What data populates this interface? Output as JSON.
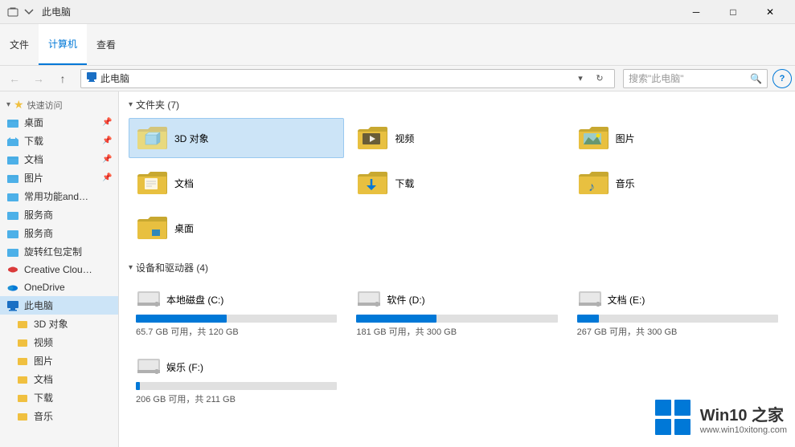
{
  "titleBar": {
    "title": "此电脑",
    "minLabel": "─",
    "maxLabel": "□",
    "closeLabel": "✕"
  },
  "ribbon": {
    "tabs": [
      {
        "id": "file",
        "label": "文件"
      },
      {
        "id": "computer",
        "label": "计算机"
      },
      {
        "id": "view",
        "label": "查看"
      }
    ]
  },
  "toolbar": {
    "backLabel": "←",
    "forwardLabel": "→",
    "upLabel": "↑",
    "addressIcon": "▶",
    "addressPrefix": "此电脑",
    "addressPath": "此电脑",
    "refreshLabel": "↻",
    "searchPlaceholder": "搜索\"此电脑\"",
    "searchIcon": "🔍",
    "helpLabel": "?"
  },
  "sidebar": {
    "quickAccessLabel": "快速访问",
    "items": [
      {
        "id": "desktop",
        "label": "桌面",
        "pinned": true,
        "icon": "folder-blue"
      },
      {
        "id": "downloads",
        "label": "下载",
        "pinned": true,
        "icon": "folder-blue"
      },
      {
        "id": "documents",
        "label": "文档",
        "pinned": true,
        "icon": "folder-blue"
      },
      {
        "id": "pictures",
        "label": "图片",
        "pinned": true,
        "icon": "folder-blue"
      },
      {
        "id": "common",
        "label": "常用功能and弹窗",
        "pinned": false,
        "icon": "folder-blue"
      },
      {
        "id": "service1",
        "label": "服务商",
        "pinned": false,
        "icon": "folder-blue"
      },
      {
        "id": "service2",
        "label": "服务商",
        "pinned": false,
        "icon": "folder-blue"
      },
      {
        "id": "spin",
        "label": "旋转红包定制",
        "pinned": false,
        "icon": "folder-blue"
      }
    ],
    "creativeCloud": {
      "label": "Creative Cloud F",
      "icon": "creative-cloud"
    },
    "oneDrive": {
      "label": "OneDrive",
      "icon": "onedrive"
    },
    "thisPC": {
      "label": "此电脑",
      "active": true,
      "icon": "thispc"
    },
    "thisPCItems": [
      {
        "id": "3dobjects",
        "label": "3D 对象",
        "icon": "folder-small"
      },
      {
        "id": "video",
        "label": "视频",
        "icon": "folder-small"
      },
      {
        "id": "pictures2",
        "label": "图片",
        "icon": "folder-small"
      },
      {
        "id": "documents2",
        "label": "文档",
        "icon": "folder-small"
      },
      {
        "id": "downloads2",
        "label": "下载",
        "icon": "folder-small"
      },
      {
        "id": "music",
        "label": "音乐",
        "icon": "folder-small"
      }
    ]
  },
  "content": {
    "foldersSection": {
      "label": "文件夹 (7)",
      "items": [
        {
          "id": "3dobjects",
          "label": "3D 对象",
          "icon": "3d"
        },
        {
          "id": "video",
          "label": "视频",
          "icon": "video"
        },
        {
          "id": "pictures",
          "label": "图片",
          "icon": "pictures"
        },
        {
          "id": "documents",
          "label": "文档",
          "icon": "documents"
        },
        {
          "id": "downloads",
          "label": "下载",
          "icon": "downloads"
        },
        {
          "id": "music",
          "label": "音乐",
          "icon": "music"
        },
        {
          "id": "desktop",
          "label": "桌面",
          "icon": "desktop"
        }
      ]
    },
    "devicesSection": {
      "label": "设备和驱动器 (4)",
      "items": [
        {
          "id": "c",
          "label": "本地磁盘 (C:)",
          "freeGB": "65.7 GB 可用，共 120 GB",
          "totalGB": 120,
          "freeGBNum": 65.7,
          "fillColor": "#0078d7",
          "fillPct": 45
        },
        {
          "id": "d",
          "label": "软件 (D:)",
          "freeGB": "181 GB 可用，共 300 GB",
          "totalGB": 300,
          "freeGBNum": 181,
          "fillColor": "#0078d7",
          "fillPct": 40
        },
        {
          "id": "e",
          "label": "文档 (E:)",
          "freeGB": "267 GB 可用，共 300 GB",
          "totalGB": 300,
          "freeGBNum": 267,
          "fillColor": "#0078d7",
          "fillPct": 11
        },
        {
          "id": "f",
          "label": "娱乐 (F:)",
          "freeGB": "206 GB 可用，共 211 GB",
          "totalGB": 211,
          "freeGBNum": 206,
          "fillColor": "#0078d7",
          "fillPct": 2
        }
      ]
    }
  },
  "watermark": {
    "title": "Win10 之家",
    "subtitle": "www.win10xitong.com"
  }
}
